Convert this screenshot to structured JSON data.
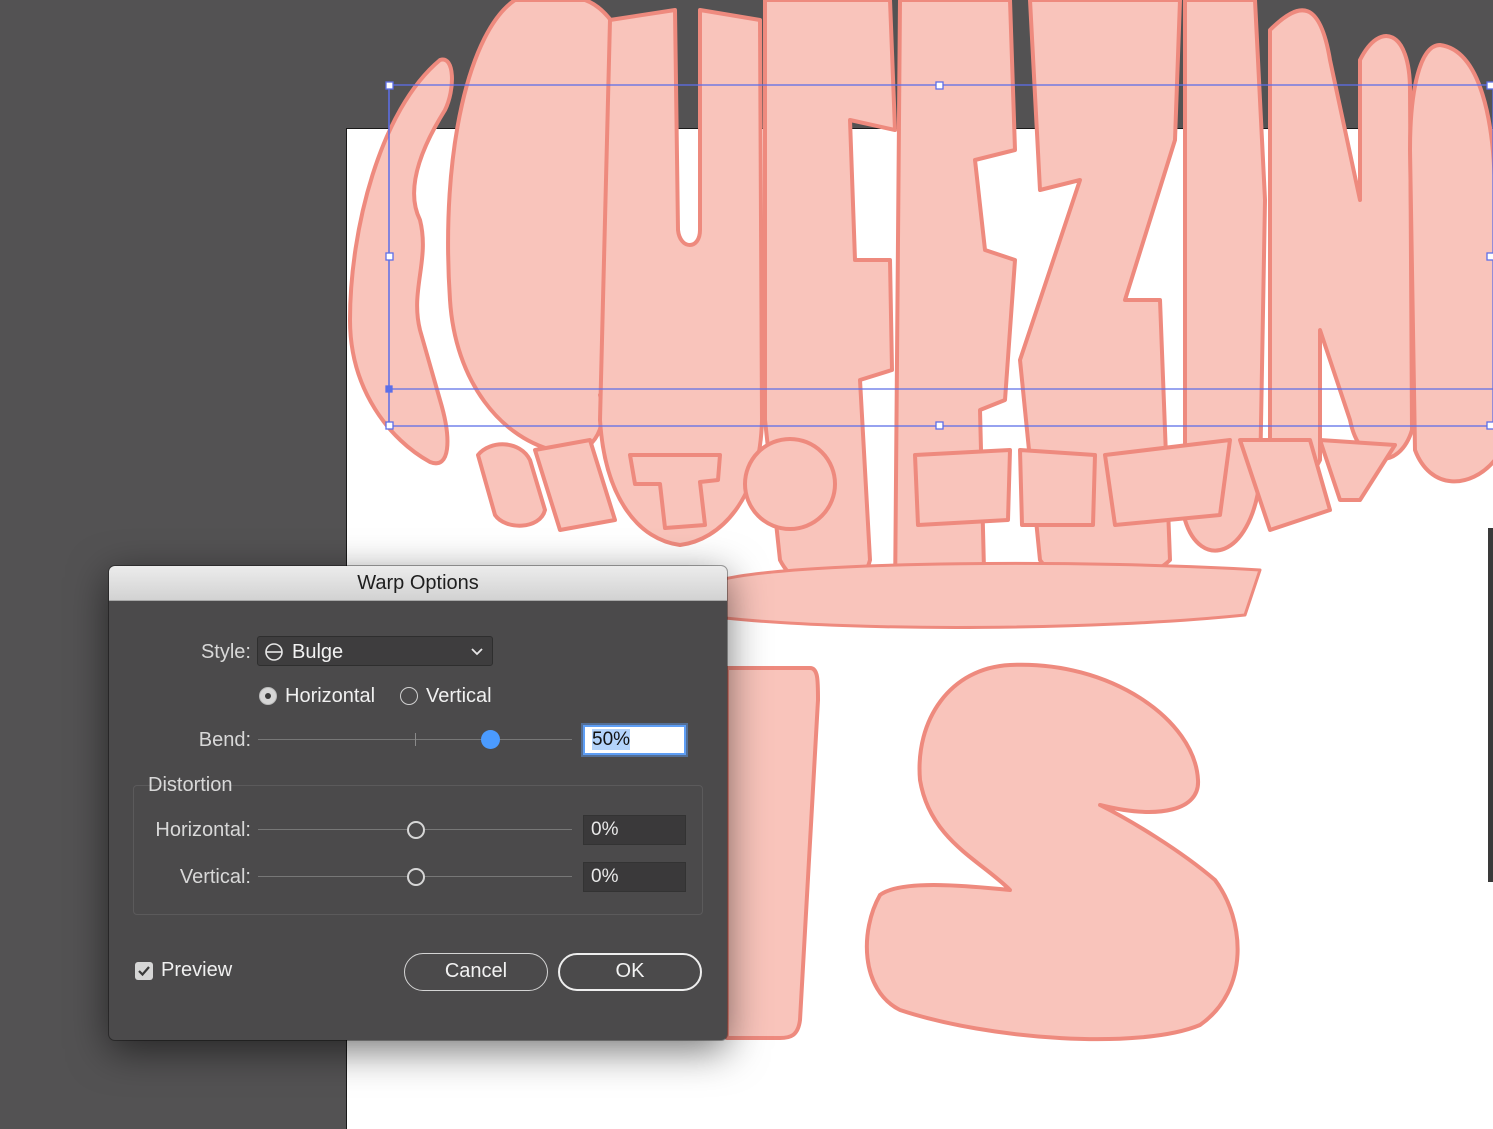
{
  "dialog": {
    "title": "Warp Options",
    "style_label": "Style:",
    "style_value": "Bulge",
    "orientation": {
      "horizontal_label": "Horizontal",
      "vertical_label": "Vertical",
      "selected": "Horizontal"
    },
    "bend": {
      "label": "Bend:",
      "value": "50%",
      "slider_percent": 50
    },
    "distortion": {
      "heading": "Distortion",
      "horizontal": {
        "label": "Horizontal:",
        "value": "0%",
        "slider_percent": 0
      },
      "vertical": {
        "label": "Vertical:",
        "value": "0%",
        "slider_percent": 0
      }
    },
    "preview": {
      "label": "Preview",
      "checked": true
    },
    "buttons": {
      "cancel": "Cancel",
      "ok": "OK"
    }
  },
  "colors": {
    "workspace": "#535253",
    "artboard": "#ffffff",
    "letter_fill": "#f9c4bb",
    "letter_stroke": "#ee8a7e",
    "selection": "#5d6fe8",
    "accent": "#4b9bff"
  }
}
